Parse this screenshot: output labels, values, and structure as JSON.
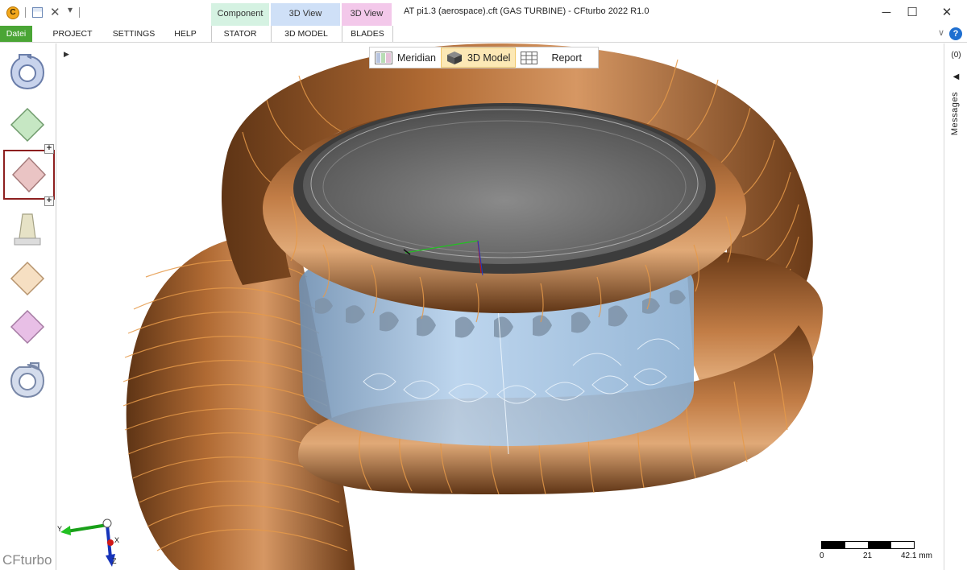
{
  "window": {
    "title": "AT pi1.3 (aerospace).cft (GAS TURBINE) - CFturbo 2022 R1.0",
    "minimize_glyph": "─",
    "maximize_glyph": "☐",
    "close_glyph": "✕"
  },
  "quick_access": {
    "logo_letter": "C",
    "close_glyph": "✕",
    "more_glyph": "▾"
  },
  "context_tabs": {
    "component": "Component",
    "view3d_a": "3D View",
    "view3d_b": "3D View"
  },
  "ribbon_tabs": {
    "datei": "Datei",
    "project": "PROJECT",
    "settings": "SETTINGS",
    "help": "HELP",
    "stator": "STATOR",
    "model3d": "3D MODEL",
    "blades": "BLADES",
    "help_glyph": "?",
    "collapse_glyph": "∨"
  },
  "sidebar": {
    "components": [
      {
        "name": "volute",
        "color": "#b9c8e8"
      },
      {
        "name": "stator",
        "color": "#bfe3bf"
      },
      {
        "name": "stator-selected",
        "color": "#e8b9b9"
      },
      {
        "name": "nozzle",
        "color": "#e6e1c4"
      },
      {
        "name": "stator-orange",
        "color": "#f4dcbf"
      },
      {
        "name": "stator-pink",
        "color": "#e6b8e4"
      },
      {
        "name": "volute-outlet",
        "color": "#b9c8e8"
      }
    ],
    "plus_glyph": "+",
    "brand": "CFturbo"
  },
  "view_toolbar": {
    "meridian": "Meridian",
    "model3d": "3D Model",
    "report": "Report"
  },
  "viewport": {
    "expand_glyph": "▶",
    "axis_x": "X",
    "axis_y": "Y",
    "axis_z": "Z"
  },
  "scale": {
    "ticks": [
      "0",
      "21",
      "42.1 mm"
    ]
  },
  "messages": {
    "count": "(0)",
    "arrow": "◀",
    "label": "Messages"
  },
  "colors": {
    "accent_green": "#4aa535",
    "copper": "#b86a32",
    "blade_blue": "#9cc3e6",
    "selection": "#8d1f1f"
  }
}
